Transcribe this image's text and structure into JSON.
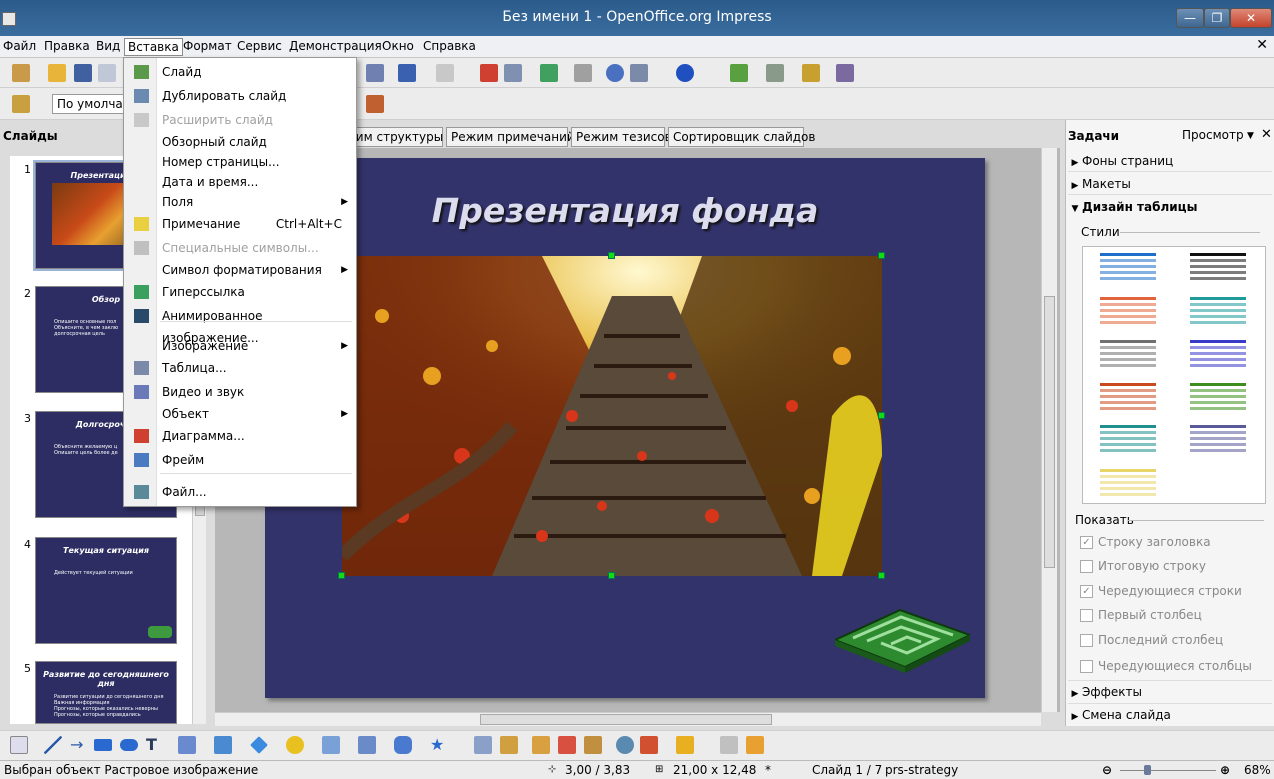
{
  "window": {
    "title": "Без имени 1 - OpenOffice.org Impress",
    "min": "—",
    "max": "❐",
    "close": "✕"
  },
  "menubar": {
    "items": [
      "Файл",
      "Правка",
      "Вид",
      "Вставка",
      "Формат",
      "Сервис",
      "Демонстрация",
      "Окно",
      "Справка"
    ],
    "active": "Вставка",
    "doc_close": "✕"
  },
  "toolbar2": {
    "style_combo": "По умолчан"
  },
  "slides_panel": {
    "title": "Слайды",
    "thumbnails": [
      {
        "num": "1",
        "title": "Презентация ф",
        "lines": []
      },
      {
        "num": "2",
        "title": "Обзор",
        "lines": [
          "Опишите основные пол",
          "Объясните, в чем заклю",
          "долгосрочная цель"
        ]
      },
      {
        "num": "3",
        "title": "Долгосрочна",
        "lines": [
          "Объясните желаемую ц",
          "Опишите цель более де"
        ]
      },
      {
        "num": "4",
        "title": "Текущая ситуация",
        "lines": [
          "Действует текущей ситуации"
        ]
      },
      {
        "num": "5",
        "title": "Развитие до сегодняшнего дня",
        "lines": [
          "Развитие ситуации до сегодняшнего дня",
          "Важная информация",
          "Прогнозы, которые оказались неверны",
          "Прогнозы, которые оправдались"
        ]
      }
    ]
  },
  "view_tabs": [
    "жим структуры",
    "Режим примечаний",
    "Режим тезисов",
    "Сортировщик слайдов"
  ],
  "slide": {
    "title": "Презентация фонда"
  },
  "tasks_panel": {
    "title": "Задачи",
    "view_label": "Просмотр",
    "close": "✕",
    "sections": [
      {
        "label": "Фоны страниц",
        "expanded": false
      },
      {
        "label": "Макеты",
        "expanded": false
      },
      {
        "label": "Дизайн таблицы",
        "expanded": true
      }
    ],
    "styles_label": "Стили",
    "show_label": "Показать",
    "options": [
      {
        "label": "Строку заголовка",
        "checked": true
      },
      {
        "label": "Итоговую строку",
        "checked": false
      },
      {
        "label": "Чередующиеся строки",
        "checked": true
      },
      {
        "label": "Первый столбец",
        "checked": false
      },
      {
        "label": "Последний столбец",
        "checked": false
      },
      {
        "label": "Чередующиеся столбцы",
        "checked": false
      }
    ],
    "bottom_sections": [
      {
        "label": "Эффекты"
      },
      {
        "label": "Смена слайда"
      }
    ],
    "swatch_colors": [
      "#1d6fc9",
      "#111111",
      "#e2643c",
      "#1d9a9a",
      "#707070",
      "#3a3ac8",
      "#c84a1e",
      "#3c8f1e",
      "#1f8f8f",
      "#5a5a9a",
      "#e8d56a"
    ]
  },
  "insert_menu": {
    "items": [
      {
        "label": "Слайд",
        "icon": "slide-icon"
      },
      {
        "label": "Дублировать слайд",
        "icon": "duplicate-slide-icon"
      },
      {
        "label": "Расширить слайд",
        "icon": "expand-slide-icon",
        "disabled": true
      },
      {
        "label": "Обзорный слайд"
      },
      {
        "label": "Номер страницы..."
      },
      {
        "label": "Дата и время..."
      },
      {
        "label": "Поля",
        "submenu": true
      },
      {
        "label": "Примечание",
        "shortcut": "Ctrl+Alt+C",
        "icon": "comment-icon"
      },
      {
        "label": "Специальные символы...",
        "icon": "special-chars-icon",
        "disabled": true
      },
      {
        "label": "Символ форматирования",
        "submenu": true
      },
      {
        "label": "Гиперссылка",
        "icon": "hyperlink-icon"
      },
      {
        "label": "Анимированное изображение...",
        "icon": "animated-image-icon"
      },
      {
        "label": "Изображение",
        "submenu": true
      },
      {
        "label": "Таблица...",
        "icon": "table-icon"
      },
      {
        "label": "Видео и звук",
        "icon": "media-icon"
      },
      {
        "label": "Объект",
        "submenu": true
      },
      {
        "label": "Диаграмма...",
        "icon": "chart-icon"
      },
      {
        "label": "Фрейм",
        "icon": "frame-icon"
      },
      {
        "label": "Файл...",
        "icon": "file-icon"
      }
    ]
  },
  "statusbar": {
    "selection": "Выбран объект Растровое изображение",
    "position": "3,00 / 3,83",
    "size": "21,00 x 12,48",
    "modified": "*",
    "slide_info": "Слайд 1 / 7",
    "design": "prs-strategy",
    "zoom": "68%"
  }
}
